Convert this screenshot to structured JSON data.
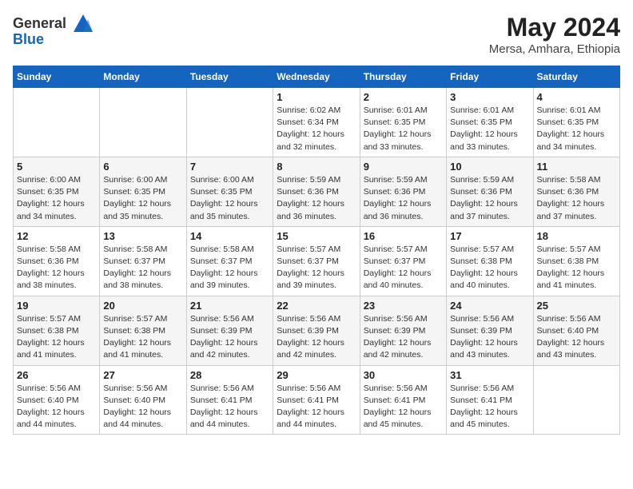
{
  "header": {
    "logo_line1": "General",
    "logo_line2": "Blue",
    "month_title": "May 2024",
    "location": "Mersa, Amhara, Ethiopia"
  },
  "weekdays": [
    "Sunday",
    "Monday",
    "Tuesday",
    "Wednesday",
    "Thursday",
    "Friday",
    "Saturday"
  ],
  "weeks": [
    [
      {
        "day": "",
        "info": ""
      },
      {
        "day": "",
        "info": ""
      },
      {
        "day": "",
        "info": ""
      },
      {
        "day": "1",
        "info": "Sunrise: 6:02 AM\nSunset: 6:34 PM\nDaylight: 12 hours\nand 32 minutes."
      },
      {
        "day": "2",
        "info": "Sunrise: 6:01 AM\nSunset: 6:35 PM\nDaylight: 12 hours\nand 33 minutes."
      },
      {
        "day": "3",
        "info": "Sunrise: 6:01 AM\nSunset: 6:35 PM\nDaylight: 12 hours\nand 33 minutes."
      },
      {
        "day": "4",
        "info": "Sunrise: 6:01 AM\nSunset: 6:35 PM\nDaylight: 12 hours\nand 34 minutes."
      }
    ],
    [
      {
        "day": "5",
        "info": "Sunrise: 6:00 AM\nSunset: 6:35 PM\nDaylight: 12 hours\nand 34 minutes."
      },
      {
        "day": "6",
        "info": "Sunrise: 6:00 AM\nSunset: 6:35 PM\nDaylight: 12 hours\nand 35 minutes."
      },
      {
        "day": "7",
        "info": "Sunrise: 6:00 AM\nSunset: 6:35 PM\nDaylight: 12 hours\nand 35 minutes."
      },
      {
        "day": "8",
        "info": "Sunrise: 5:59 AM\nSunset: 6:36 PM\nDaylight: 12 hours\nand 36 minutes."
      },
      {
        "day": "9",
        "info": "Sunrise: 5:59 AM\nSunset: 6:36 PM\nDaylight: 12 hours\nand 36 minutes."
      },
      {
        "day": "10",
        "info": "Sunrise: 5:59 AM\nSunset: 6:36 PM\nDaylight: 12 hours\nand 37 minutes."
      },
      {
        "day": "11",
        "info": "Sunrise: 5:58 AM\nSunset: 6:36 PM\nDaylight: 12 hours\nand 37 minutes."
      }
    ],
    [
      {
        "day": "12",
        "info": "Sunrise: 5:58 AM\nSunset: 6:36 PM\nDaylight: 12 hours\nand 38 minutes."
      },
      {
        "day": "13",
        "info": "Sunrise: 5:58 AM\nSunset: 6:37 PM\nDaylight: 12 hours\nand 38 minutes."
      },
      {
        "day": "14",
        "info": "Sunrise: 5:58 AM\nSunset: 6:37 PM\nDaylight: 12 hours\nand 39 minutes."
      },
      {
        "day": "15",
        "info": "Sunrise: 5:57 AM\nSunset: 6:37 PM\nDaylight: 12 hours\nand 39 minutes."
      },
      {
        "day": "16",
        "info": "Sunrise: 5:57 AM\nSunset: 6:37 PM\nDaylight: 12 hours\nand 40 minutes."
      },
      {
        "day": "17",
        "info": "Sunrise: 5:57 AM\nSunset: 6:38 PM\nDaylight: 12 hours\nand 40 minutes."
      },
      {
        "day": "18",
        "info": "Sunrise: 5:57 AM\nSunset: 6:38 PM\nDaylight: 12 hours\nand 41 minutes."
      }
    ],
    [
      {
        "day": "19",
        "info": "Sunrise: 5:57 AM\nSunset: 6:38 PM\nDaylight: 12 hours\nand 41 minutes."
      },
      {
        "day": "20",
        "info": "Sunrise: 5:57 AM\nSunset: 6:38 PM\nDaylight: 12 hours\nand 41 minutes."
      },
      {
        "day": "21",
        "info": "Sunrise: 5:56 AM\nSunset: 6:39 PM\nDaylight: 12 hours\nand 42 minutes."
      },
      {
        "day": "22",
        "info": "Sunrise: 5:56 AM\nSunset: 6:39 PM\nDaylight: 12 hours\nand 42 minutes."
      },
      {
        "day": "23",
        "info": "Sunrise: 5:56 AM\nSunset: 6:39 PM\nDaylight: 12 hours\nand 42 minutes."
      },
      {
        "day": "24",
        "info": "Sunrise: 5:56 AM\nSunset: 6:39 PM\nDaylight: 12 hours\nand 43 minutes."
      },
      {
        "day": "25",
        "info": "Sunrise: 5:56 AM\nSunset: 6:40 PM\nDaylight: 12 hours\nand 43 minutes."
      }
    ],
    [
      {
        "day": "26",
        "info": "Sunrise: 5:56 AM\nSunset: 6:40 PM\nDaylight: 12 hours\nand 44 minutes."
      },
      {
        "day": "27",
        "info": "Sunrise: 5:56 AM\nSunset: 6:40 PM\nDaylight: 12 hours\nand 44 minutes."
      },
      {
        "day": "28",
        "info": "Sunrise: 5:56 AM\nSunset: 6:41 PM\nDaylight: 12 hours\nand 44 minutes."
      },
      {
        "day": "29",
        "info": "Sunrise: 5:56 AM\nSunset: 6:41 PM\nDaylight: 12 hours\nand 44 minutes."
      },
      {
        "day": "30",
        "info": "Sunrise: 5:56 AM\nSunset: 6:41 PM\nDaylight: 12 hours\nand 45 minutes."
      },
      {
        "day": "31",
        "info": "Sunrise: 5:56 AM\nSunset: 6:41 PM\nDaylight: 12 hours\nand 45 minutes."
      },
      {
        "day": "",
        "info": ""
      }
    ]
  ]
}
